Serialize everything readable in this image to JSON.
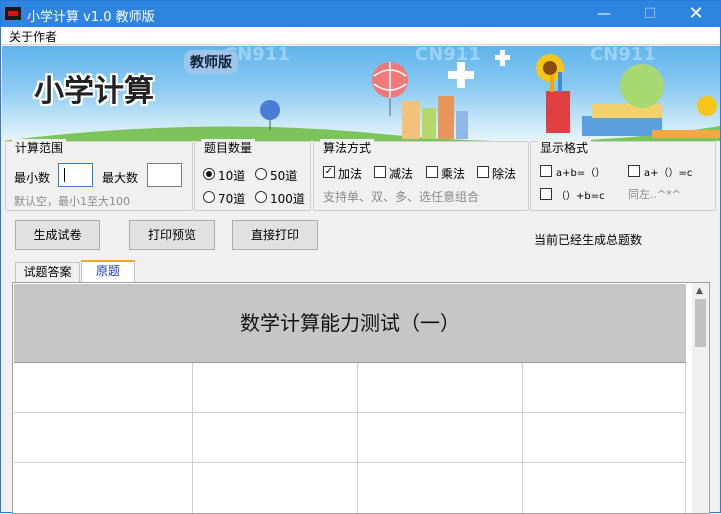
{
  "window": {
    "title": "小学计算 v1.0 教师版"
  },
  "menu": {
    "about": "关于作者"
  },
  "banner": {
    "title": "小学计算",
    "badge": "教师版",
    "watermark": "CN911"
  },
  "range": {
    "group": "计算范围",
    "min_label": "最小数",
    "min_value": "",
    "max_label": "最大数",
    "max_value": "",
    "hint": "默认空，最小1至大100"
  },
  "count": {
    "group": "题目数量",
    "options": [
      "10道",
      "50道",
      "70道",
      "100道"
    ],
    "selected": "10道"
  },
  "ops": {
    "group": "算法方式",
    "items": [
      "加法",
      "减法",
      "乘法",
      "除法"
    ],
    "checked": [
      "加法"
    ],
    "hint": "支持单、双、多、选任意组合"
  },
  "format": {
    "group": "显示格式",
    "f1": "a+b=（）",
    "f2": "a+（）=c",
    "f3": "（）+b=c",
    "hint": "同左..^*^"
  },
  "actions": {
    "generate": "生成试卷",
    "preview": "打印预览",
    "print": "直接打印"
  },
  "status": "当前已经生成总题数",
  "tabs": {
    "answers": "试题答案",
    "original": "原题"
  },
  "paper": {
    "title": "数学计算能力测试（一）"
  }
}
